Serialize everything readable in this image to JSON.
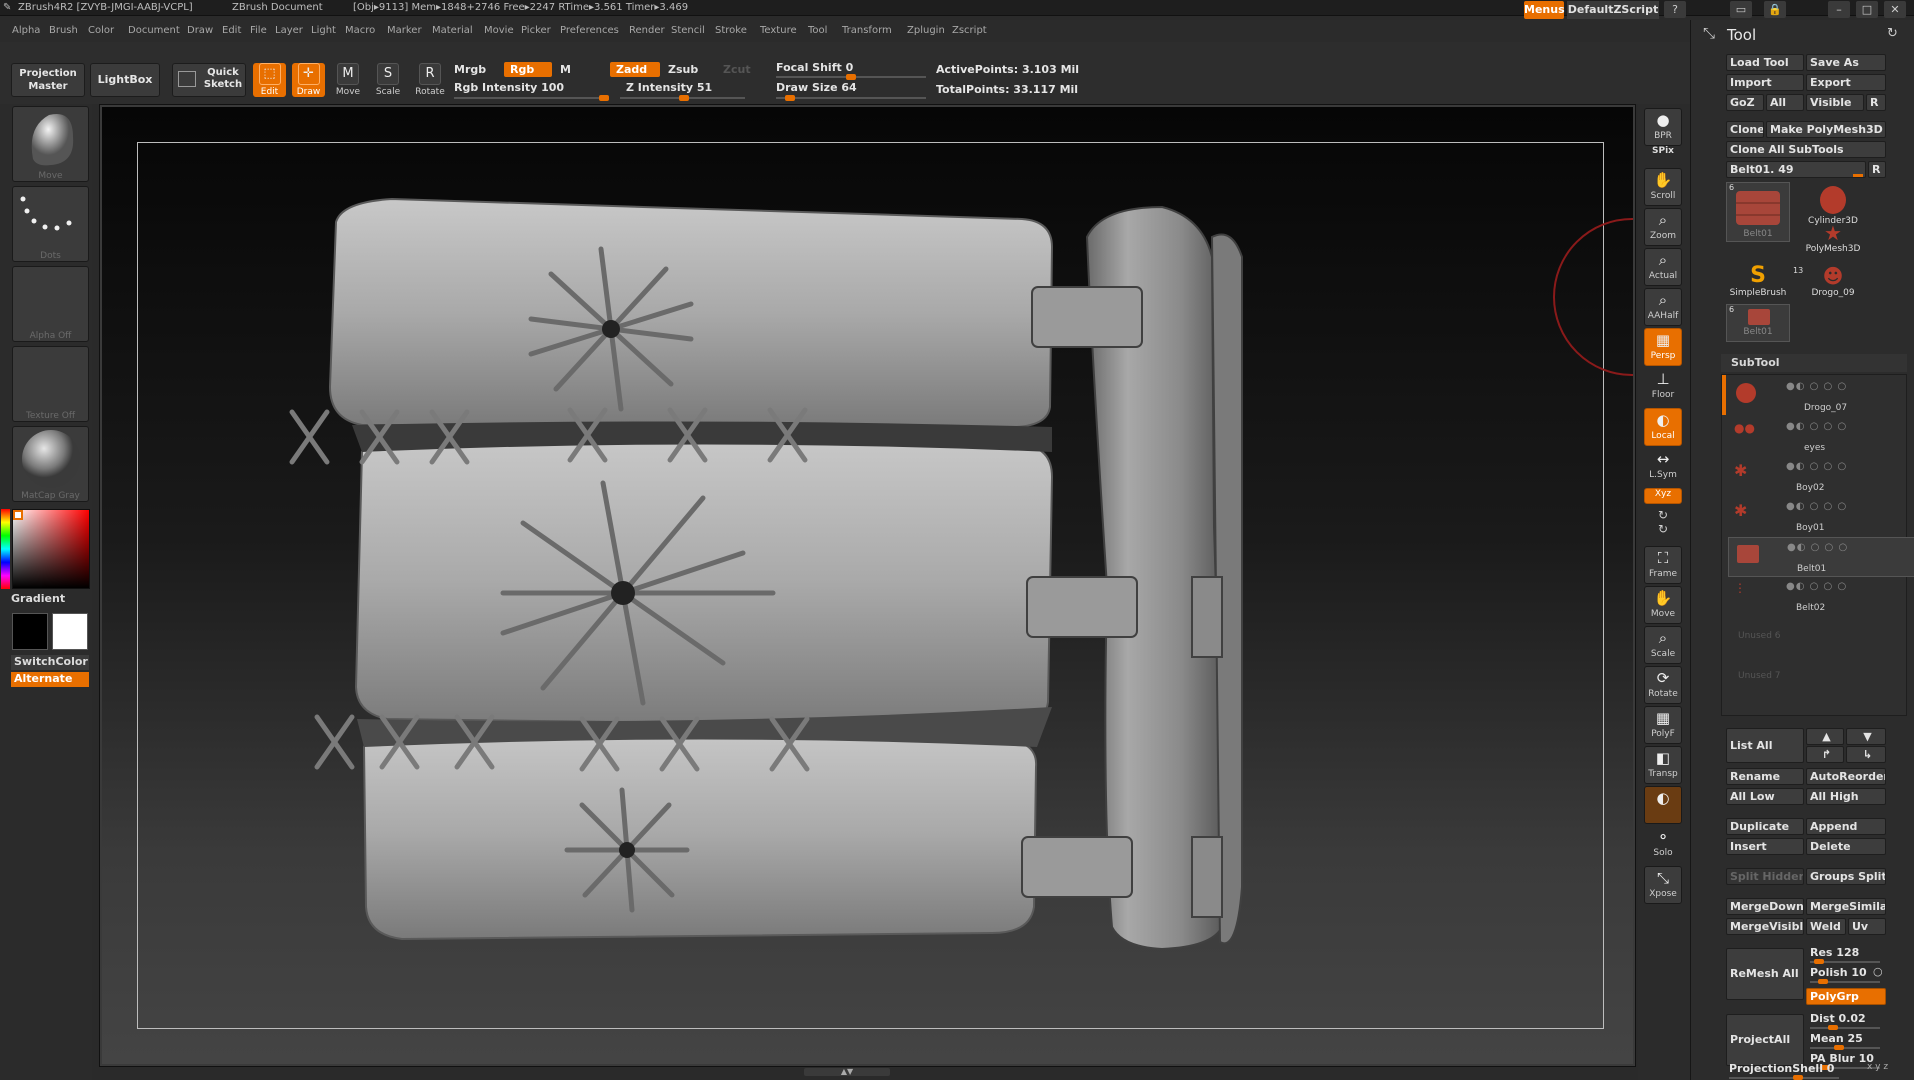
{
  "titlebar": {
    "app": "ZBrush4R2 [ZVYB-JMGI-AABJ-VCPL]",
    "doc": "ZBrush Document",
    "stats": "[Obj▸9113] Mem▸1848+2746 Free▸2247 RTime▸3.561 Timer▸3.469",
    "menus_label": "Menus",
    "script_label": "DefaultZScript"
  },
  "menubar": [
    "Alpha",
    "Brush",
    "Color",
    "Document",
    "Draw",
    "Edit",
    "File",
    "Layer",
    "Light",
    "Macro",
    "Marker",
    "Material",
    "Movie",
    "Picker",
    "Preferences",
    "Render",
    "Stencil",
    "Stroke",
    "Texture",
    "Tool",
    "Transform",
    "Zplugin",
    "Zscript"
  ],
  "toolbar": {
    "projection_master": "Projection Master",
    "lightbox": "LightBox",
    "quick_sketch": "Quick Sketch",
    "edit": "Edit",
    "draw": "Draw",
    "move": "Move",
    "scale": "Scale",
    "rotate": "Rotate",
    "mrgb": "Mrgb",
    "rgb": "Rgb",
    "m": "M",
    "rgb_intensity": "Rgb Intensity 100",
    "zadd": "Zadd",
    "zsub": "Zsub",
    "zcut": "Zcut",
    "z_intensity": "Z Intensity 51",
    "focal_shift": "Focal Shift 0",
    "draw_size": "Draw Size 64",
    "active_points": "ActivePoints: 3.103 Mil",
    "total_points": "TotalPoints: 33.117 Mil",
    "rgb_intensity_value": 100,
    "z_intensity_value": 51,
    "focal_shift_value": 0,
    "draw_size_value": 64
  },
  "leftshelf": {
    "brush": "Move",
    "stroke": "Dots",
    "alpha": "Alpha Off",
    "texture": "Texture Off",
    "material": "MatCap Gray",
    "gradient": "Gradient",
    "switchcolor": "SwitchColor",
    "alternate": "Alternate"
  },
  "rightshelf": [
    "BPR",
    "SPix",
    "Scroll",
    "Zoom",
    "Actual",
    "AAHalf",
    "Persp",
    "Floor",
    "Local",
    "L.Sym",
    "Xyz",
    "Frame",
    "Move",
    "Scale",
    "Rotate",
    "PolyF",
    "Transp",
    "Ghost",
    "Solo",
    "Xpose"
  ],
  "tool": {
    "title": "Tool",
    "load_tool": "Load Tool",
    "save_as": "Save As",
    "import": "Import",
    "export": "Export",
    "goz": "GoZ",
    "all": "All",
    "visible": "Visible",
    "r": "R",
    "clone": "Clone",
    "make_polymesh": "Make PolyMesh3D",
    "clone_all": "Clone All SubTools",
    "current_tool": "Belt01. 49",
    "tiles": [
      {
        "name": "Belt01",
        "count": "6"
      },
      {
        "name": "Cylinder3D",
        "count": ""
      },
      {
        "name": "PolyMesh3D",
        "count": ""
      },
      {
        "name": "SimpleBrush",
        "count": ""
      },
      {
        "name": "Drogo_09",
        "count": "13"
      },
      {
        "name": "Belt01",
        "count": "6"
      }
    ]
  },
  "subtool": {
    "title": "SubTool",
    "items": [
      {
        "name": "Drogo_07"
      },
      {
        "name": "eyes"
      },
      {
        "name": "Boy02"
      },
      {
        "name": "Boy01"
      },
      {
        "name": "Belt01"
      },
      {
        "name": "Belt02"
      },
      {
        "name": "Unused 6"
      },
      {
        "name": "Unused 7"
      }
    ],
    "list_all": "List All",
    "rename": "Rename",
    "autoreorder": "AutoReorder",
    "all_low": "All Low",
    "all_high": "All High",
    "duplicate": "Duplicate",
    "append": "Append",
    "insert": "Insert",
    "delete": "Delete",
    "split_hidden": "Split Hidden",
    "groups_split": "Groups Split",
    "mergedown": "MergeDown",
    "mergesimilar": "MergeSimilar",
    "mergevisible": "MergeVisible",
    "weld": "Weld",
    "uv": "Uv",
    "remesh_all": "ReMesh All",
    "res": "Res 128",
    "polish": "Polish 10",
    "polygrp": "PolyGrp",
    "projectall": "ProjectAll",
    "dist": "Dist 0.02",
    "mean": "Mean 25",
    "pa_blur": "PA Blur 10",
    "projection_shell": "ProjectionShell 0"
  },
  "colors": {
    "accent": "#e86f00",
    "panel": "#2c2c2c",
    "button": "#3d3d3d"
  }
}
